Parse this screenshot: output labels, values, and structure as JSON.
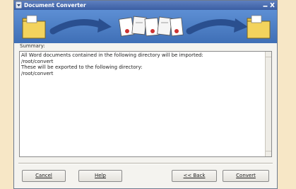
{
  "window": {
    "title": "Document Converter"
  },
  "summary": {
    "label": "Summary:",
    "lines": [
      "All Word documents contained in the following directory will be imported:",
      "/root/convert",
      "These will be exported to the following directory:",
      "/root/convert"
    ]
  },
  "buttons": {
    "cancel": "Cancel",
    "help": "Help",
    "back": "<< Back",
    "convert": "Convert"
  },
  "icons": {
    "menu": "window-menu-icon",
    "minimize": "minimize-icon",
    "close": "close-icon",
    "source_folder": "folder-icon",
    "target_folder": "folder-icon",
    "conversion": "documents-icon",
    "arrows": "arrow-icon"
  },
  "colors": {
    "titlebar": "#3b5ea3",
    "banner": "#4f81c7",
    "background": "#f7e7c6"
  }
}
